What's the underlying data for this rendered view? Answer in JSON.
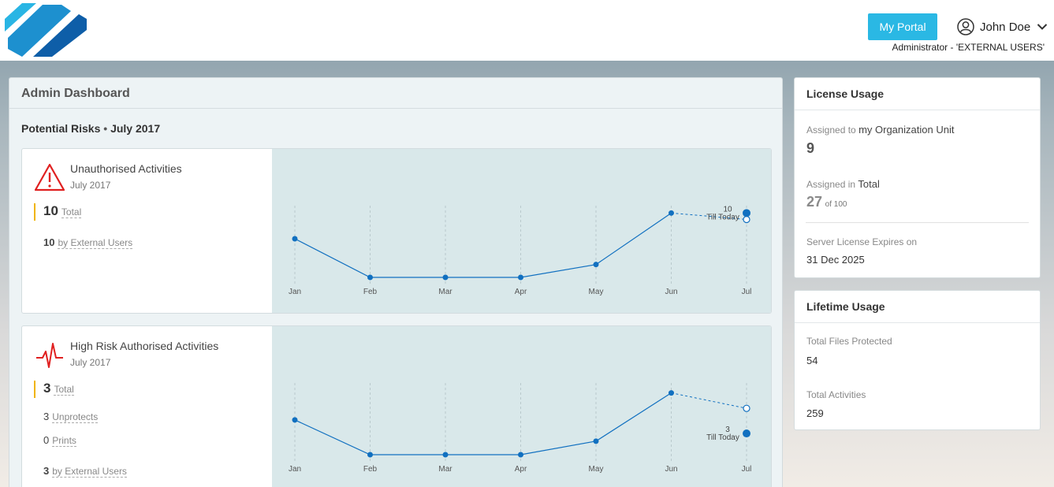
{
  "header": {
    "portal_label": "My Portal",
    "user_name": "John Doe",
    "role": "Administrator - 'EXTERNAL USERS'"
  },
  "dashboard": {
    "title": "Admin Dashboard",
    "section_label": "Potential Risks",
    "section_separator": "•",
    "section_period": "July 2017"
  },
  "risk_cards": [
    {
      "title": "Unauthorised Activities",
      "subtitle": "July 2017",
      "total": "10",
      "total_label": "Total",
      "stats": [
        {
          "value": "10",
          "label": "by External Users",
          "bold": true
        }
      ],
      "today_value": "10",
      "today_label": "Till Today"
    },
    {
      "title": "High Risk Authorised Activities",
      "subtitle": "July 2017",
      "total": "3",
      "total_label": "Total",
      "stats": [
        {
          "value": "3",
          "label": "Unprotects",
          "bold": false
        },
        {
          "value": "0",
          "label": "Prints",
          "bold": false
        },
        {
          "value": "3",
          "label": "by External Users",
          "bold": true
        }
      ],
      "today_value": "3",
      "today_label": "Till Today"
    }
  ],
  "chart_data": [
    {
      "type": "line",
      "categories": [
        "Jan",
        "Feb",
        "Mar",
        "Apr",
        "May",
        "Jun",
        "Jul"
      ],
      "values": [
        6,
        0,
        0,
        0,
        2,
        10,
        9
      ],
      "projected_last": true,
      "today_value": 10,
      "ylim": [
        0,
        12
      ],
      "grid": "vertical-dashed",
      "color": "#1170c0"
    },
    {
      "type": "line",
      "categories": [
        "Jan",
        "Feb",
        "Mar",
        "Apr",
        "May",
        "Jun",
        "Jul"
      ],
      "values": [
        1.8,
        0,
        0,
        0,
        0.7,
        3.2,
        2.4
      ],
      "projected_last": true,
      "today_value": 1.1,
      "ylim": [
        0,
        4
      ],
      "grid": "vertical-dashed",
      "color": "#1170c0"
    }
  ],
  "license": {
    "title": "License Usage",
    "assigned_prefix": "Assigned to",
    "assigned_unit": "my Organization Unit",
    "assigned_value": "9",
    "total_prefix": "Assigned in",
    "total_label": "Total",
    "total_value": "27",
    "total_of": "of 100",
    "expires_label": "Server License Expires on",
    "expires_value": "31 Dec 2025"
  },
  "lifetime": {
    "title": "Lifetime Usage",
    "files_label": "Total Files Protected",
    "files_value": "54",
    "activities_label": "Total Activities",
    "activities_value": "259"
  },
  "colors": {
    "accent": "#2ab8e4",
    "line": "#1170c0",
    "risk_red": "#e02020",
    "total_bar": "#f0b400"
  }
}
